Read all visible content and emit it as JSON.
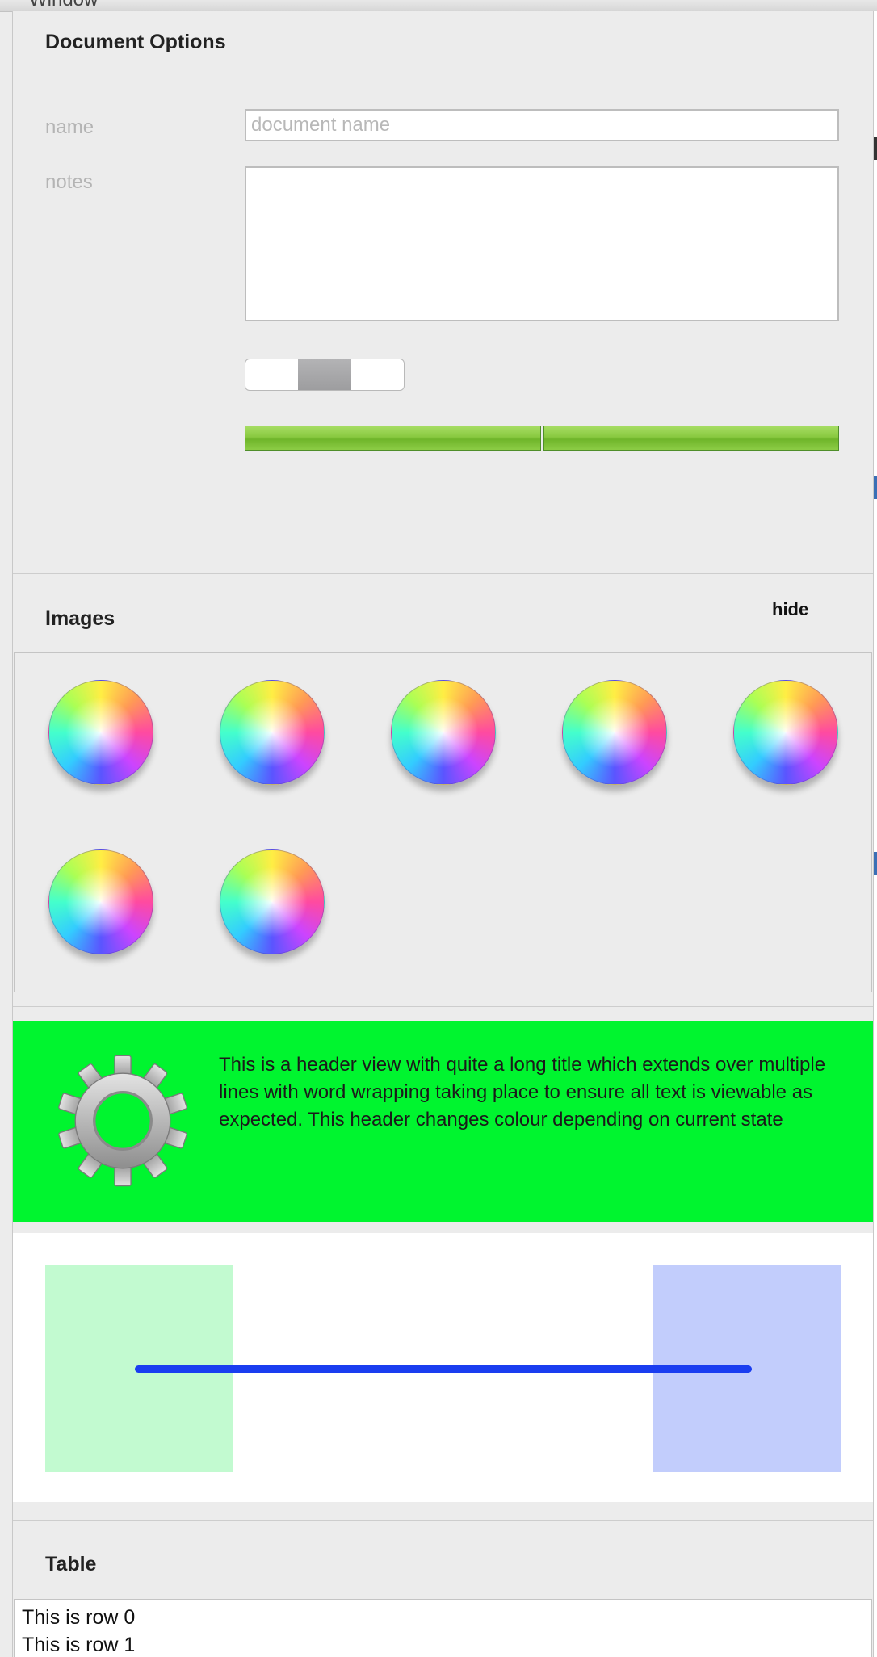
{
  "window": {
    "title": "Window"
  },
  "document_options": {
    "title": "Document Options",
    "name_label": "name",
    "name_placeholder": "document name",
    "name_value": "",
    "notes_label": "notes",
    "notes_value": "",
    "segmented": {
      "segment_count": 3,
      "selected_index": 1
    },
    "progress": {
      "segments": 2,
      "value": 1.0,
      "color": "#7fc23a"
    }
  },
  "images": {
    "title": "Images",
    "hide_label": "hide",
    "items": [
      {
        "icon": "color-wheel-icon"
      },
      {
        "icon": "color-wheel-icon"
      },
      {
        "icon": "color-wheel-icon"
      },
      {
        "icon": "color-wheel-icon"
      },
      {
        "icon": "color-wheel-icon"
      },
      {
        "icon": "color-wheel-icon"
      },
      {
        "icon": "color-wheel-icon"
      }
    ]
  },
  "header_view": {
    "icon": "gear-icon",
    "text": "This is a header view with quite a long title which extends over multiple lines with word wrapping taking place to ensure all text is viewable as expected. This header changes colour depending on current state",
    "background_color": "#00f52f"
  },
  "drag_view": {
    "left_color": "#c0fac9",
    "right_color": "#c2ccfb",
    "line_color": "#1a3df0"
  },
  "table": {
    "title": "Table",
    "rows": [
      "This is row 0",
      "This is row 1"
    ]
  }
}
